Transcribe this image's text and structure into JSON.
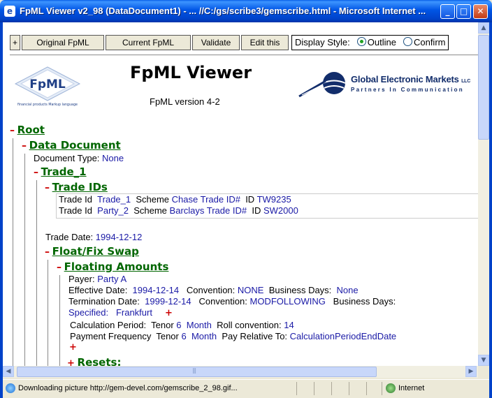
{
  "window": {
    "title": "FpML Viewer v2_98 (DataDocument1) - ... //C:/gs/scribe3/gemscribe.html - Microsoft Internet ...",
    "controls": {
      "minimize": "_",
      "maximize": "□",
      "close": "✕"
    }
  },
  "toolbar": {
    "expand_label": "+",
    "original_label": "Original FpML",
    "current_label": "Current FpML",
    "validate_label": "Validate",
    "edit_label": "Edit this",
    "display_style_label": "Display Style:",
    "outline_label": "Outline",
    "confirm_label": "Confirm",
    "selected_style": "Outline"
  },
  "header": {
    "fpml_logo_text": "FpML",
    "fpml_logo_tagline": "financial products Markup language",
    "title": "FpML Viewer",
    "version": "FpML version 4-2",
    "gem_name": "Global Electronic Markets",
    "gem_llc": "LLC",
    "gem_tagline": "Partners In Communication"
  },
  "tree": {
    "toggle_open": "–",
    "root": "Root",
    "data_document": "Data Document",
    "document_type_label": "Document Type:",
    "document_type": "None",
    "trade": "Trade_1",
    "trade_ids": "Trade IDs",
    "trade_id_rows": [
      {
        "label": "Trade Id",
        "party": "Trade_1",
        "scheme_label": "Scheme",
        "scheme": "Chase Trade ID#",
        "id_label": "ID",
        "id": "TW9235"
      },
      {
        "label": "Trade Id",
        "party": "Party_2",
        "scheme_label": "Scheme",
        "scheme": "Barclays Trade ID#",
        "id_label": "ID",
        "id": "SW2000"
      }
    ],
    "trade_date_label": "Trade Date:",
    "trade_date": "1994-12-12",
    "swap": "Float/Fix Swap",
    "floating_amounts": "Floating Amounts",
    "payer_label": "Payer:",
    "payer": "Party A",
    "effective_date_label": "Effective Date:",
    "effective_date": "1994-12-14",
    "convention_label": "Convention:",
    "effective_convention": "NONE",
    "business_days_label": "Business Days:",
    "effective_business_days": "None",
    "termination_date_label": "Termination Date:",
    "termination_date": "1999-12-14",
    "termination_convention": "MODFOLLOWING",
    "specified_label": "Specified:",
    "specified_value": "Frankfurt",
    "plus": "+",
    "calc_period_label": "Calculation Period:",
    "tenor_label": "Tenor",
    "calc_tenor_n": "6",
    "calc_tenor_unit": "Month",
    "roll_label": "Roll convention:",
    "roll_value": "14",
    "pay_freq_label": "Payment Frequency",
    "pay_tenor_n": "6",
    "pay_tenor_unit": "Month",
    "pay_relative_label": "Pay Relative To:",
    "pay_relative_value": "CalculationPeriodEndDate",
    "resets": "Resets:"
  },
  "status": {
    "text": "Downloading picture http://gem-devel.com/gemscribe_2_98.gif...",
    "zone": "Internet"
  },
  "colors": {
    "heading": "#006600",
    "value": "#1A1AA6",
    "toggle": "#CC0000",
    "titlebar": "#0055E5"
  }
}
